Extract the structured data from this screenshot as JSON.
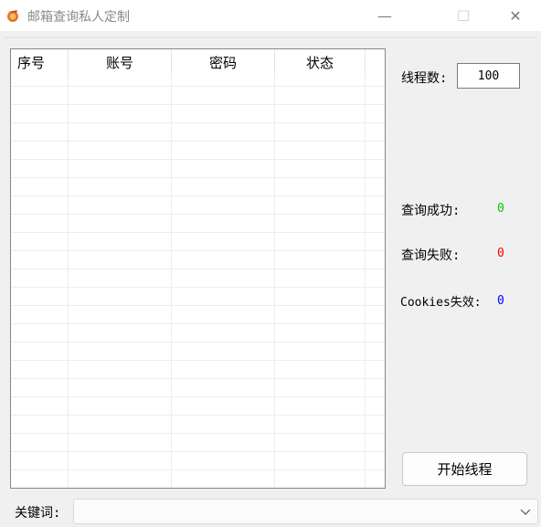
{
  "window": {
    "title": "邮箱查询私人定制",
    "minimize_glyph": "—",
    "maximize_glyph": "☐",
    "close_glyph": "✕"
  },
  "table": {
    "columns": [
      "序号",
      "账号",
      "密码",
      "状态"
    ],
    "rows": []
  },
  "settings": {
    "threads_label": "线程数:",
    "threads_value": "100"
  },
  "stats": {
    "success_label": "查询成功:",
    "success_value": "0",
    "success_color": "#00c800",
    "fail_label": "查询失败:",
    "fail_value": "0",
    "fail_color": "#ff0000",
    "cookies_label": "Cookies失效:",
    "cookies_value": "0",
    "cookies_color": "#0000ff"
  },
  "actions": {
    "start_label": "开始线程"
  },
  "keyword": {
    "label": "关键词:",
    "value": ""
  },
  "icons": {
    "app": "app-icon",
    "dropdown": "chevron-down-icon"
  }
}
